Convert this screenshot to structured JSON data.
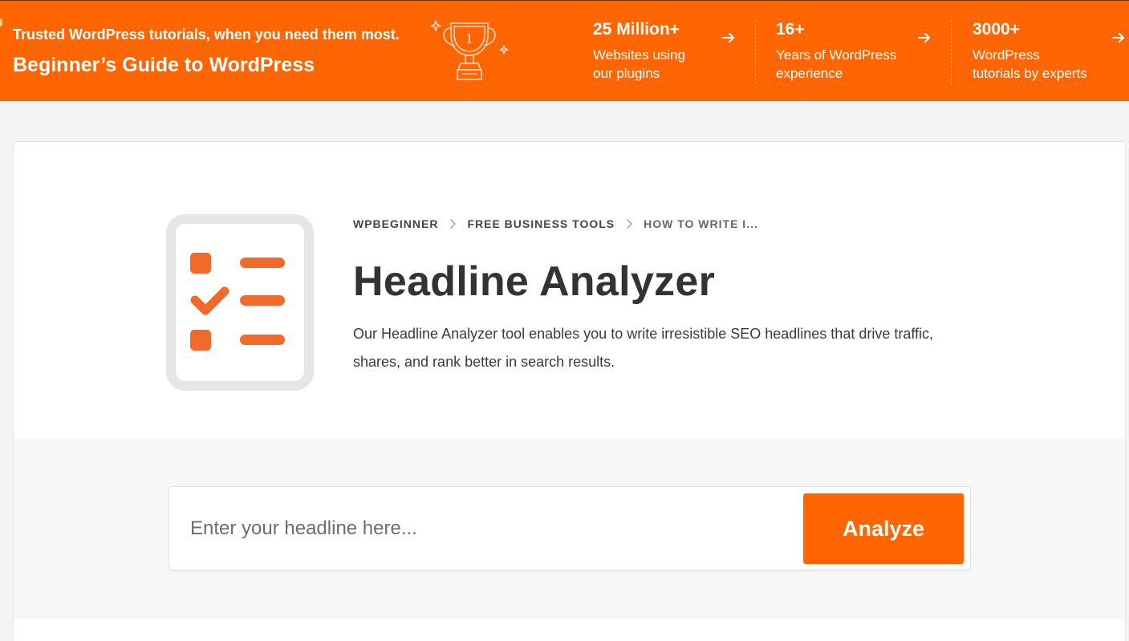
{
  "banner": {
    "tagline": "Trusted WordPress tutorials, when you need them most.",
    "title": "Beginner’s Guide to WordPress",
    "trophy_number": "1",
    "stats": [
      {
        "number": "25 Million+",
        "desc_line1": "Websites using",
        "desc_line2": "our plugins"
      },
      {
        "number": "16+",
        "desc_line1": "Years of WordPress",
        "desc_line2": "experience"
      },
      {
        "number": "3000+",
        "desc_line1": "WordPress",
        "desc_line2": "tutorials by experts"
      }
    ]
  },
  "breadcrumb": [
    {
      "label": "WPBEGINNER"
    },
    {
      "label": "FREE BUSINESS TOOLS"
    },
    {
      "label": "HOW TO WRITE I..."
    }
  ],
  "page": {
    "title": "Headline Analyzer",
    "description": "Our Headline Analyzer tool enables you to write irresistible SEO headlines that drive traffic, shares, and rank better in search results."
  },
  "analyzer": {
    "placeholder": "Enter your headline here...",
    "value": "",
    "button_label": "Analyze"
  },
  "colors": {
    "brand_orange": "#ff6500",
    "icon_orange": "#f26a2a",
    "icon_frame": "#e6e6e6",
    "text_dark": "#333333"
  },
  "icons": {
    "hero": "checklist-icon",
    "trophy": "trophy-icon",
    "arrow": "arrow-right-icon",
    "breadcrumb_separator": "chevron-right-icon"
  }
}
